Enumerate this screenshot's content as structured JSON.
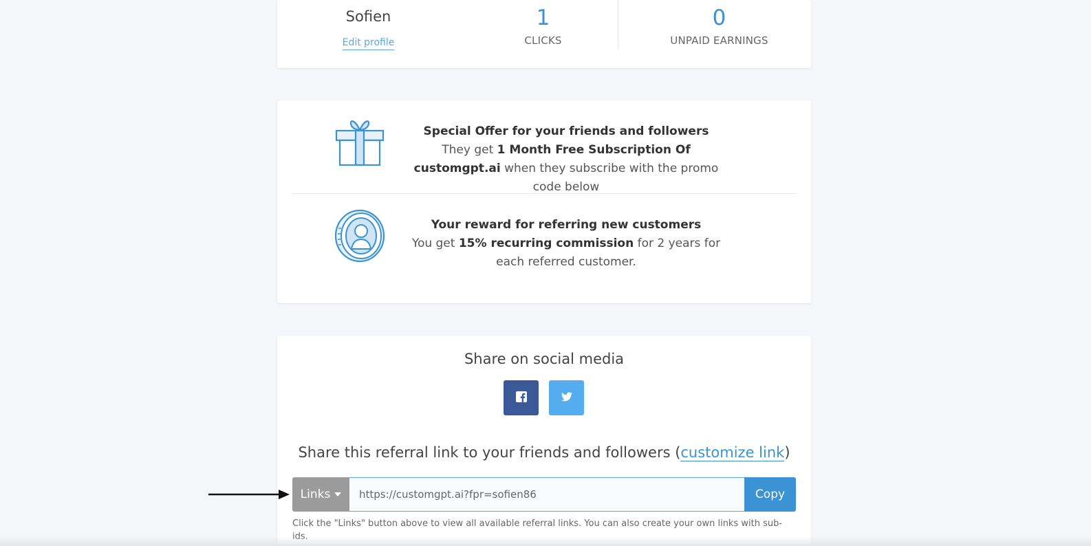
{
  "profile": {
    "username": "Sofien",
    "edit_label": "Edit profile"
  },
  "stats": {
    "clicks_value": "1",
    "clicks_label": "CLICKS",
    "earnings_value": "0",
    "earnings_label": "UNPAID EARNINGS"
  },
  "offer": {
    "headline": "Special Offer for your friends and followers",
    "line_prefix": "They get ",
    "line_bold": "1 Month Free Subscription Of customgpt.ai",
    "line_suffix": " when they subscribe with the promo code below",
    "icon": "gift-icon"
  },
  "reward": {
    "headline": "Your reward for referring new customers",
    "line_prefix": "You get ",
    "line_bold": "15% recurring commission",
    "line_suffix": " for 2 years for each referred customer.",
    "icon": "coin-user-icon"
  },
  "share": {
    "title": "Share on social media",
    "facebook_icon": "facebook-icon",
    "twitter_icon": "twitter-icon",
    "referral_prefix": "Share this referral link to your friends and followers (",
    "customize_label": "customize link",
    "referral_suffix": ")",
    "links_label": "Links",
    "link_value": "https://customgpt.ai?fpr=sofien86",
    "copy_label": "Copy",
    "help_text": "Click the \"Links\" button above to view all available referral links. You can also create your own links with sub-ids."
  },
  "colors": {
    "accent": "#3b93d6",
    "facebook": "#3b5998",
    "twitter": "#55acee",
    "links_button": "#9b9b9b",
    "background": "#f4f6f9"
  }
}
